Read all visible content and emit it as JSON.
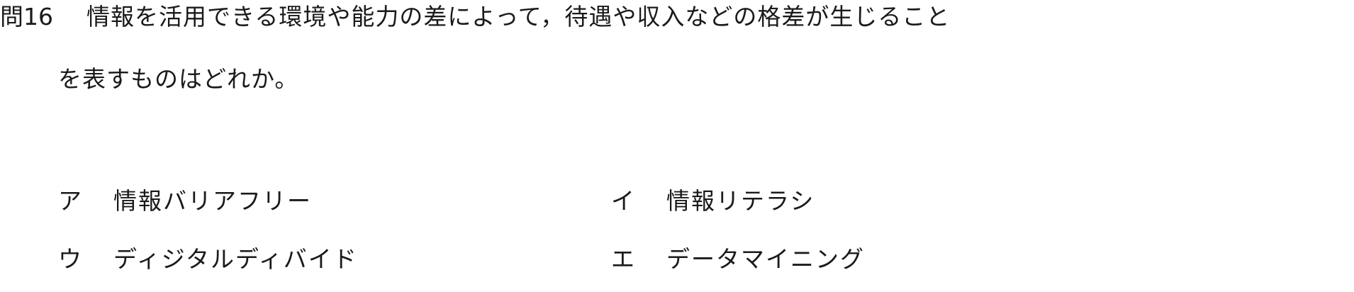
{
  "question": {
    "number": "問16",
    "line1": "情報を活用できる環境や能力の差によって，待遇や収入などの格差が生じること",
    "line2": "を表すものはどれか。"
  },
  "choices": [
    {
      "label": "ア",
      "text": "情報バリアフリー"
    },
    {
      "label": "イ",
      "text": "情報リテラシ"
    },
    {
      "label": "ウ",
      "text": "ディジタルディバイド"
    },
    {
      "label": "エ",
      "text": "データマイニング"
    }
  ]
}
